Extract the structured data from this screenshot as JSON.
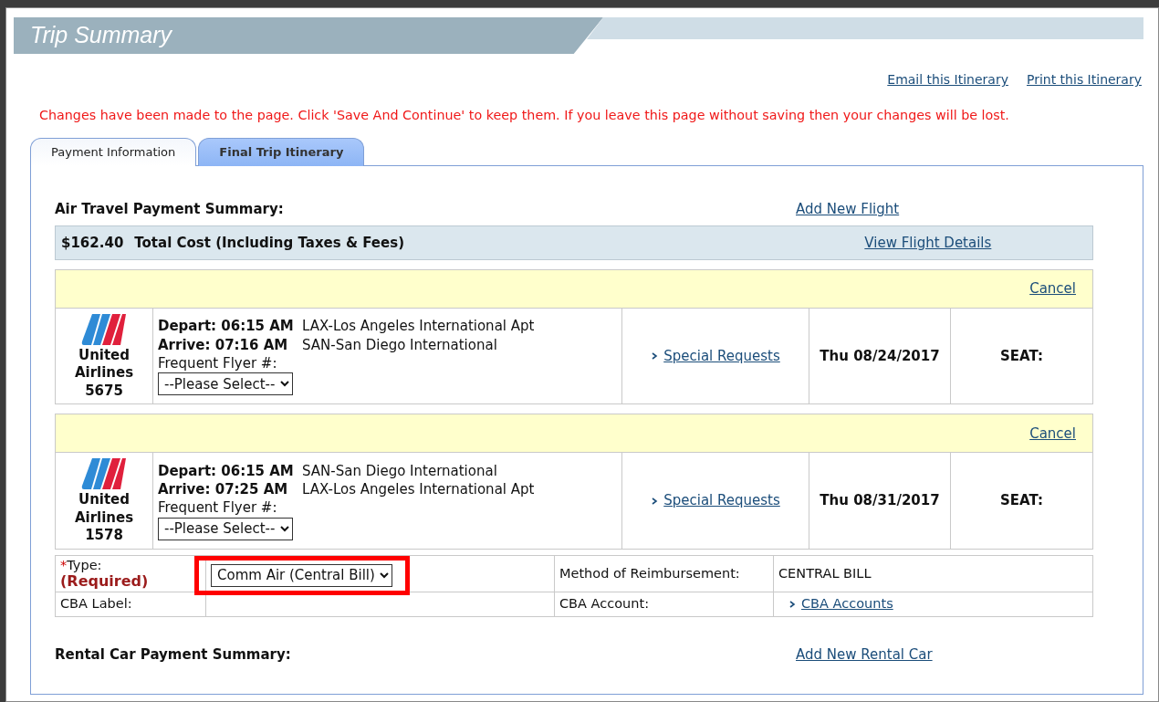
{
  "page": {
    "title": "Trip Summary"
  },
  "itinerary_links": [
    "Email this Itinerary",
    "Print this Itinerary"
  ],
  "warning": "Changes have been made to the page. Click 'Save And Continue' to keep them. If you leave this page without saving then your changes will be lost.",
  "tabs": [
    {
      "label": "Payment Information",
      "selected": true
    },
    {
      "label": "Final Trip Itinerary",
      "selected": false
    }
  ],
  "air": {
    "heading": "Air Travel Payment Summary:",
    "add_link": "Add New Flight",
    "total": "$162.40",
    "total_label": "Total Cost  (Including Taxes & Fees)",
    "details_link": "View Flight Details",
    "flights": [
      {
        "cancel": "Cancel",
        "airline": "United Airlines",
        "flight": "5675",
        "depart_label": "Depart: 06:15 AM",
        "depart_airport": "LAX-Los Angeles International Apt",
        "arrive_label": "Arrive: 07:16 AM",
        "arrive_airport": "SAN-San Diego International",
        "ff_label": "Frequent Flyer #:",
        "ff_value": "--Please Select--",
        "special": "Special Requests",
        "date": "Thu 08/24/2017",
        "seat": "SEAT:"
      },
      {
        "cancel": "Cancel",
        "airline": "United Airlines",
        "flight": "1578",
        "depart_label": "Depart: 06:15 AM",
        "depart_airport": "SAN-San Diego International",
        "arrive_label": "Arrive: 07:25 AM",
        "arrive_airport": "LAX-Los Angeles International Apt",
        "ff_label": "Frequent Flyer #:",
        "ff_value": "--Please Select--",
        "special": "Special Requests",
        "date": "Thu 08/31/2017",
        "seat": "SEAT:"
      }
    ],
    "payment": {
      "required_mark": "*",
      "type_label": "Type:",
      "required": "(Required)",
      "type_value": "Comm Air (Central Bill)",
      "highlighted": true,
      "method_label": "Method of Reimbursement:",
      "method_value": "CENTRAL BILL",
      "cba_label": "CBA Label:",
      "cba_account_label": "CBA Account:",
      "cba_link": "CBA Accounts"
    }
  },
  "rental": {
    "heading": "Rental Car Payment Summary:",
    "add_link": "Add New Rental Car"
  }
}
